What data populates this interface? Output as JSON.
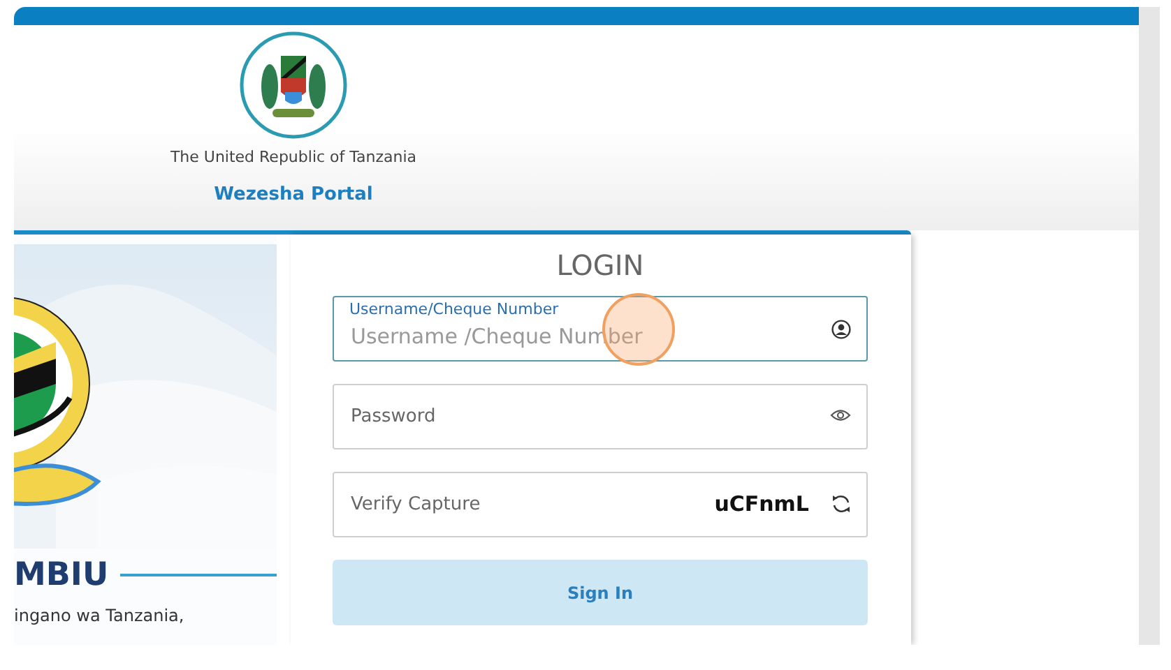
{
  "header": {
    "country": "The United Republic of Tanzania",
    "portal": "Wezesha Portal"
  },
  "side_panel": {
    "heading": "MBIU",
    "text": "ingano wa Tanzania,"
  },
  "login": {
    "title": "LOGIN",
    "fields": [
      {
        "kind": "text",
        "label": "Username/Cheque Number",
        "placeholder": "Username /Cheque Number",
        "focused": true
      },
      {
        "kind": "password",
        "placeholder": "Password",
        "focused": false
      },
      {
        "kind": "captcha",
        "placeholder": "Verify Capture",
        "code": "uCFnmL",
        "focused": false
      }
    ],
    "button": "Sign In"
  }
}
